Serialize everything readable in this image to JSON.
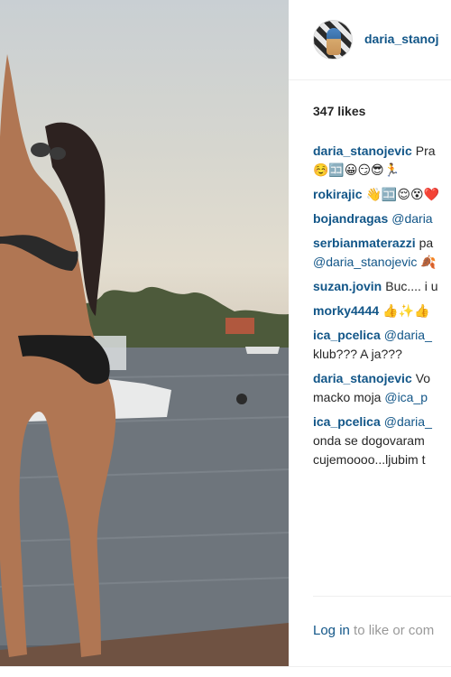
{
  "post": {
    "username": "daria_stanoj",
    "likes": "347 likes"
  },
  "comments": [
    {
      "user": "daria_stanojevic",
      "text": "Pra",
      "line2": "☺️🈁😀😏😎🏃"
    },
    {
      "user": "rokirajic",
      "text": "👋🈁😌😵❤️"
    },
    {
      "user": "bojandragas",
      "mention": "@daria"
    },
    {
      "user": "serbianmaterazzi",
      "text": "pa",
      "line2_mention": "@daria_stanojevic",
      "line2_text": " 🍂"
    },
    {
      "user": "suzan.jovin",
      "text": "Buc.... i u"
    },
    {
      "user": "morky4444",
      "text": "👍✨👍"
    },
    {
      "user": "ica_pcelica",
      "mention": "@daria_",
      "line2": "klub??? A ja???"
    },
    {
      "user": "daria_stanojevic",
      "text": "Vo",
      "line2": "macko moja ",
      "line2_mention": "@ica_p"
    },
    {
      "user": "ica_pcelica",
      "mention": "@daria_",
      "line2": "onda se dogovaram",
      "line3": "cujemoooo...ljubim t"
    }
  ],
  "footer": {
    "login_link": "Log in",
    "login_text": " to like or com"
  }
}
